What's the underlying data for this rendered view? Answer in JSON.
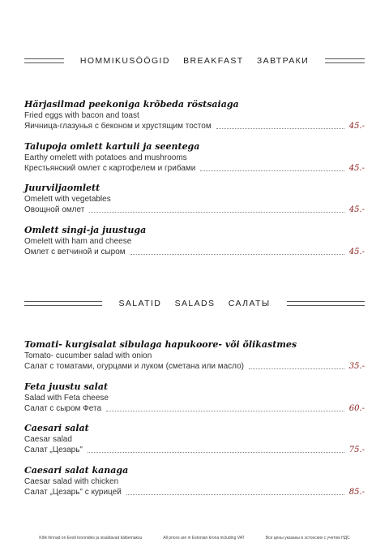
{
  "breakfast": {
    "titles": [
      "HOMMIKUSÖÖGID",
      "BREAKFAST",
      "ЗАВТРАКИ"
    ],
    "items": [
      {
        "name": "Härjasilmad peekoniga  krõbeda röstsaiaga",
        "en": "Fried eggs with bacon and toast",
        "ru": "Яичница-глазунья с беконом и хрустящим тостом",
        "price": "45.-"
      },
      {
        "name": "Talupoja omlett kartuli ja seentega",
        "en": "Earthy omelett with potatoes and mushrooms",
        "ru": "Крестьянский омлет с картофелем и грибами",
        "price": "45.-"
      },
      {
        "name": "Juurviljaomlett",
        "en": "Omelett with vegetables",
        "ru": "Овощной омлет",
        "price": "45.-"
      },
      {
        "name": "Omlett singi-ja juustuga",
        "en": "Omelett with ham and cheese",
        "ru": "Омлет с ветчиной и сыром",
        "price": "45.-"
      }
    ]
  },
  "salads": {
    "titles": [
      "SALATID",
      "SALADS",
      "САЛАТЫ"
    ],
    "items": [
      {
        "name": "Tomati- kurgisalat sibulaga hapukoore- või õlikastmes",
        "en": "Tomato- cucumber salad with onion",
        "ru": "Салат с томатами, огурцами и луком (сметана или масло)",
        "price": "35.-"
      },
      {
        "name": "Feta juustu salat",
        "en": "Salad with Feta cheese",
        "ru": "Салат с сыром Фета",
        "price": "60.-"
      },
      {
        "name": "Caesari salat",
        "en": "Caesar salad",
        "ru": "Салат „Цезарь\"",
        "price": "75.-"
      },
      {
        "name": "Caesari salat kanaga",
        "en": "Caesar salad with chicken",
        "ru": "Салат „Цезарь\" с курицей",
        "price": "85.-"
      }
    ]
  },
  "footer": {
    "et": "Kõik hinnad on Eesti kroonides ja sisaldavad käibemaksu",
    "en": "All prices are in Estonian krona including VAT",
    "ru": "Все цены указаны в эстонских с учетом НДС"
  }
}
